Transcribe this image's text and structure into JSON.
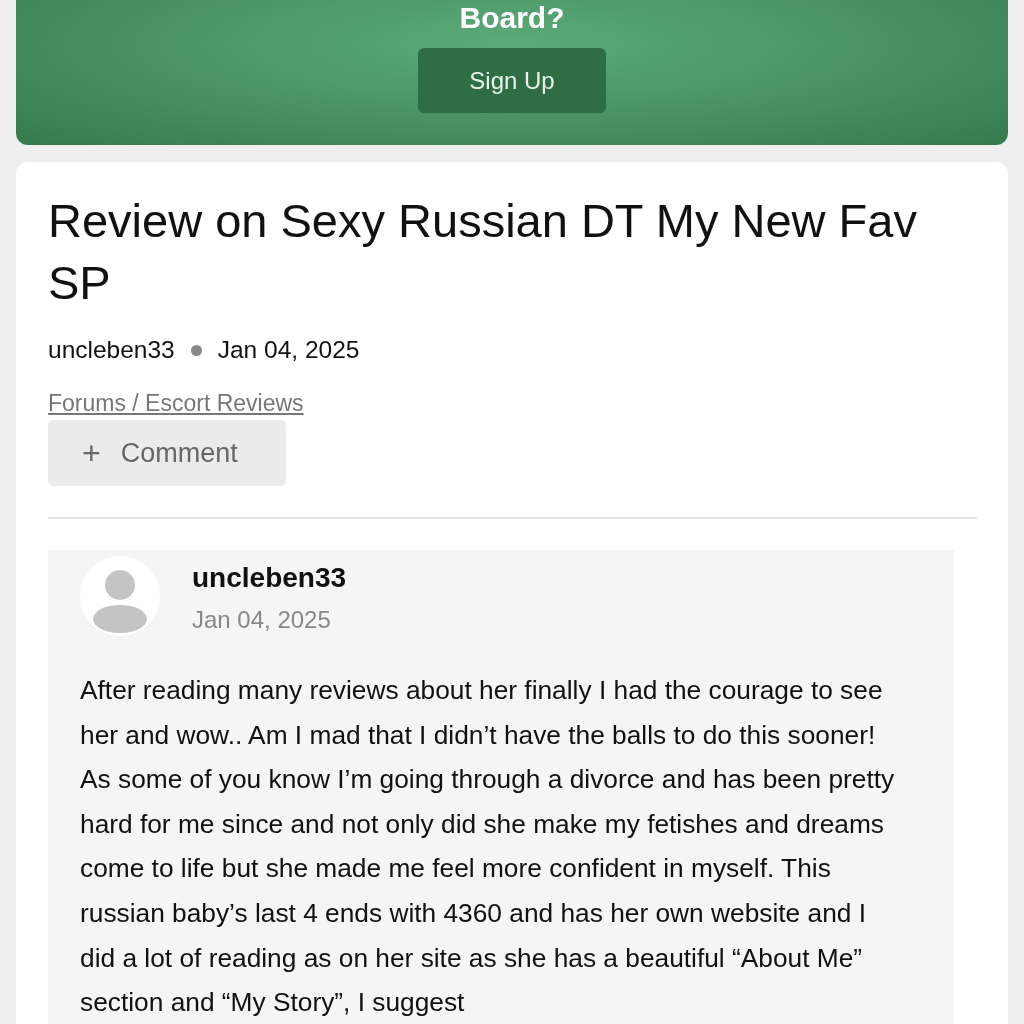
{
  "banner": {
    "heading": "Board?",
    "button": "Sign Up"
  },
  "post": {
    "title": "Review on Sexy Russian DT My New Fav SP",
    "author": "uncleben33",
    "date": "Jan 04, 2025",
    "breadcrumb": "Forums / Escort Reviews",
    "comment_button": {
      "icon": "+",
      "label": "Comment"
    }
  },
  "reply": {
    "author": "uncleben33",
    "date": "Jan 04, 2025",
    "body": "After reading many reviews about her finally I had the courage to see her and wow.. Am I mad that I didn’t have the balls to do this sooner! As some of you know I’m going through a divorce and has been pretty hard for me since and not only did she make my fetishes and dreams come to life but she made me feel more confident in myself. This russian baby’s last 4 ends with 4360 and has her own website and I did a lot of reading as on her site as she has a beautiful “About Me” section and “My Story”, I suggest"
  }
}
